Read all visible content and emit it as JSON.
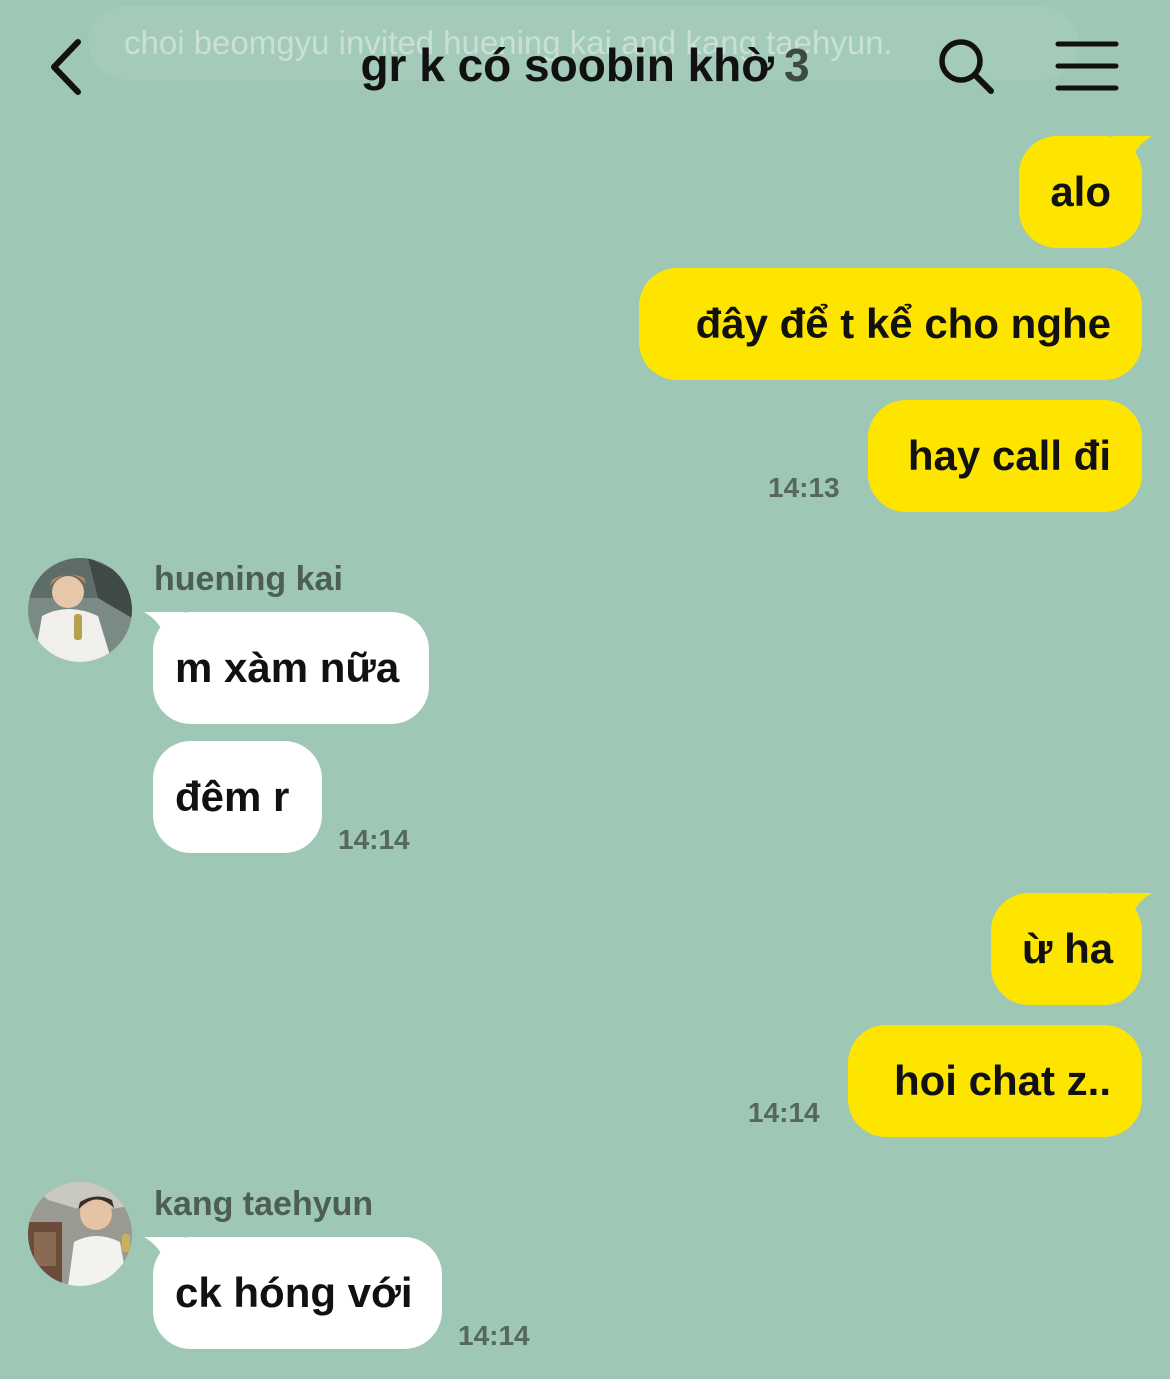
{
  "header": {
    "title": "gr k có soobin khờ",
    "member_count": "3",
    "system_notice": "choi beomgyu invited huening kai and kang taehyun."
  },
  "messages": [
    {
      "from": "me",
      "text": "alo"
    },
    {
      "from": "me",
      "text": "đây để t kể cho nghe"
    },
    {
      "from": "me",
      "text": "hay call đi",
      "time": "14:13"
    },
    {
      "from": "huening kai",
      "sender": "huening kai",
      "text": "m xàm nữa"
    },
    {
      "from": "huening kai",
      "text": "đêm r",
      "time": "14:14"
    },
    {
      "from": "me",
      "text": "ừ ha"
    },
    {
      "from": "me",
      "text": "hoi chat z..",
      "time": "14:14"
    },
    {
      "from": "kang taehyun",
      "sender": "kang taehyun",
      "text": "ck hóng với",
      "time": "14:14"
    }
  ],
  "icons": {
    "back": "chevron-left-icon",
    "search": "search-icon",
    "menu": "hamburger-menu-icon"
  },
  "colors": {
    "background": "#9fc7b5",
    "my_bubble": "#fee500",
    "their_bubble": "#ffffff",
    "timestamp": "#56675f"
  }
}
